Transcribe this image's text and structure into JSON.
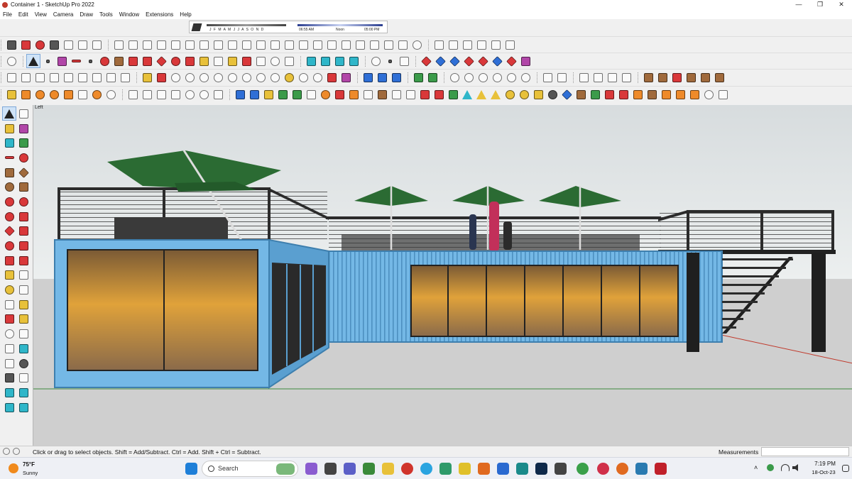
{
  "window": {
    "title": "Container 1 - SketchUp Pro 2022",
    "minimize_glyph": "—",
    "maximize_glyph": "❐",
    "close_glyph": "✕"
  },
  "menu": [
    "File",
    "Edit",
    "View",
    "Camera",
    "Draw",
    "Tools",
    "Window",
    "Extensions",
    "Help"
  ],
  "shadow": {
    "months": "J F M A M J J A S O N D",
    "time_start": "06:55 AM",
    "time_mid": "Noon",
    "time_end": "05:00 PM"
  },
  "viewport": {
    "view_label": "Left"
  },
  "status": {
    "hint": "Click or drag to select objects. Shift = Add/Subtract. Ctrl = Add. Shift + Ctrl = Subtract.",
    "measurements_label": "Measurements",
    "measurements_value": ""
  },
  "taskbar": {
    "weather_temp": "75°F",
    "weather_condition": "Sunny",
    "search_placeholder": "Search",
    "time": "7:19 PM",
    "date": "18-Oct-23"
  },
  "colors": {
    "container": "#74b8e6",
    "container_dark": "#5a9fd0",
    "umbrella": "#2b6b33",
    "ground": "#cfcfcf",
    "sky": "#e1e5e6"
  }
}
